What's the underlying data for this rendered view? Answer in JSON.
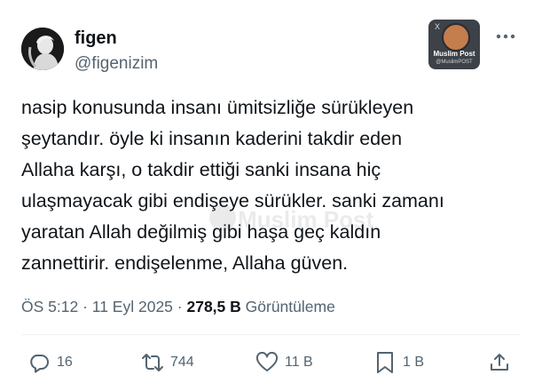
{
  "author": {
    "name": "figen",
    "handle": "@figenizim",
    "avatar_icon": "profile-silhouette-avatar"
  },
  "badge": {
    "title": "Muslim Post",
    "subtitle": "@MuslimPOST",
    "corner": "X"
  },
  "tweet": {
    "lines": [
      "nasip konusunda insanı ümitsizliğe sürükleyen",
      "şeytandır. öyle ki insanın kaderini takdir eden",
      "Allaha karşı, o takdir ettiği sanki insana hiç",
      "ulaşmayacak gibi endişeye sürükler. sanki zamanı",
      "yaratan Allah değilmiş gibi haşa geç kaldın",
      "zannettirir. endişelenme, Allaha güven."
    ]
  },
  "watermark": {
    "text": "Muslim Post"
  },
  "meta": {
    "time": "ÖS 5:12",
    "sep1": " · ",
    "date": "11 Eyl 2025",
    "sep2": " · ",
    "views_count": "278,5 B",
    "views_label": " Görüntüleme"
  },
  "actions": {
    "reply_count": "16",
    "retweet_count": "744",
    "like_count": "11 B",
    "bookmark_count": "1 B"
  },
  "colors": {
    "text": "#0f1419",
    "secondary": "#536471",
    "divider": "#eff3f4"
  }
}
